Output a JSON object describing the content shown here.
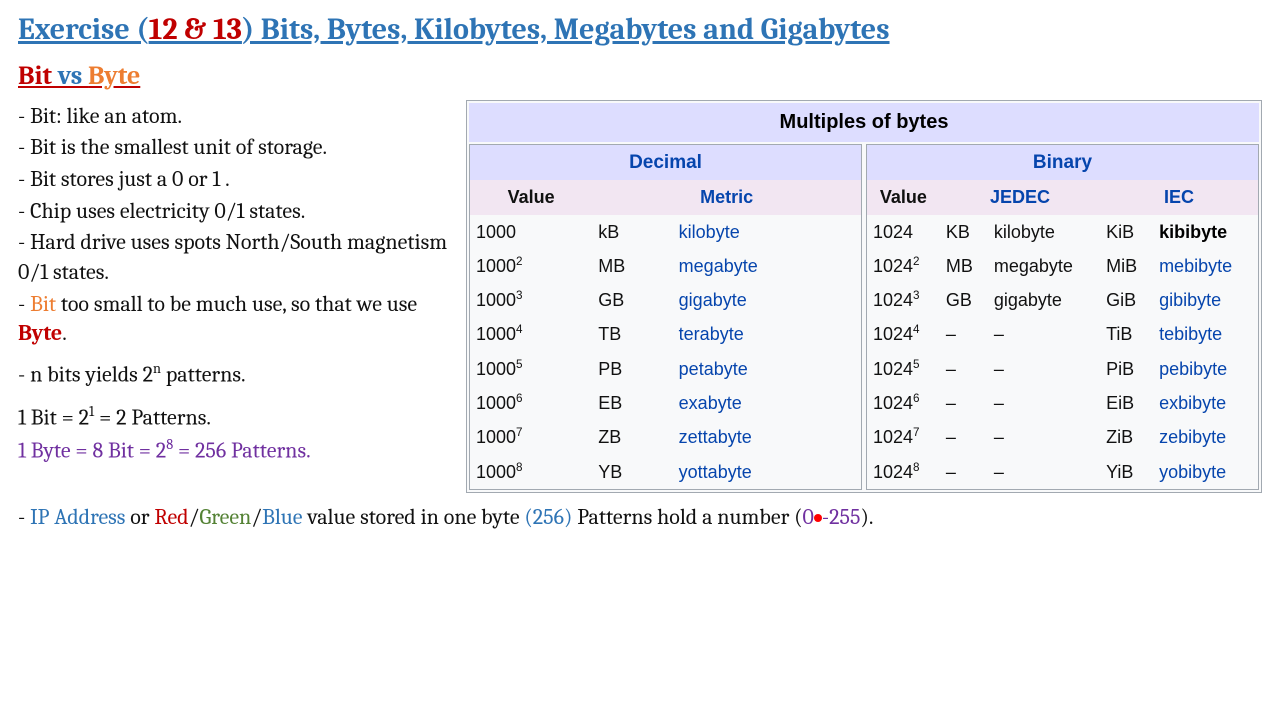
{
  "title": {
    "prefix": "Exercise (",
    "nums": "12 & 13",
    "suffix": ") Bits, Bytes, Kilobytes, Megabytes and Gigabytes"
  },
  "subtitle": {
    "bit": "Bit",
    "vs": " vs ",
    "byte": "Byte"
  },
  "bullets": {
    "b1": "- Bit: like an atom.",
    "b2": "- Bit is the smallest unit of storage.",
    "b3": "- Bit stores just a 0 or 1 .",
    "b4": "- Chip uses electricity 0/1 states.",
    "b5": "- Hard drive uses spots North/South magnetism 0/1 states.",
    "b6a": "- ",
    "b6bit": "Bit",
    "b6b": " too small to be much use, so that we use ",
    "b6byte": "Byte",
    "b6c": ".",
    "b7a": "- n bits yields 2",
    "b7exp": "n",
    "b7b": " patterns.",
    "b8a": "1 Bit = 2",
    "b8exp": "1",
    "b8b": " = 2 Patterns.",
    "b9a": "1 Byte = 8 Bit = 2",
    "b9exp": "8",
    "b9b": " = 256 Patterns."
  },
  "box": {
    "title": "Multiples of bytes"
  },
  "decimal": {
    "heading": "Decimal",
    "val": "Value",
    "met": "Metric",
    "rows": [
      {
        "v": "1000",
        "e": "",
        "a": "kB",
        "n": "kilobyte"
      },
      {
        "v": "1000",
        "e": "2",
        "a": "MB",
        "n": "megabyte"
      },
      {
        "v": "1000",
        "e": "3",
        "a": "GB",
        "n": "gigabyte"
      },
      {
        "v": "1000",
        "e": "4",
        "a": "TB",
        "n": "terabyte"
      },
      {
        "v": "1000",
        "e": "5",
        "a": "PB",
        "n": "petabyte"
      },
      {
        "v": "1000",
        "e": "6",
        "a": "EB",
        "n": "exabyte"
      },
      {
        "v": "1000",
        "e": "7",
        "a": "ZB",
        "n": "zettabyte"
      },
      {
        "v": "1000",
        "e": "8",
        "a": "YB",
        "n": "yottabyte"
      }
    ]
  },
  "binary": {
    "heading": "Binary",
    "val": "Value",
    "jed": "JEDEC",
    "iec": "IEC",
    "rows": [
      {
        "v": "1024",
        "e": "",
        "ja": "KB",
        "jn": "kilobyte",
        "ia": "KiB",
        "in": "kibibyte",
        "bold": true
      },
      {
        "v": "1024",
        "e": "2",
        "ja": "MB",
        "jn": "megabyte",
        "ia": "MiB",
        "in": "mebibyte"
      },
      {
        "v": "1024",
        "e": "3",
        "ja": "GB",
        "jn": "gigabyte",
        "ia": "GiB",
        "in": "gibibyte"
      },
      {
        "v": "1024",
        "e": "4",
        "ja": "–",
        "jn": "–",
        "ia": "TiB",
        "in": "tebibyte"
      },
      {
        "v": "1024",
        "e": "5",
        "ja": "–",
        "jn": "–",
        "ia": "PiB",
        "in": "pebibyte"
      },
      {
        "v": "1024",
        "e": "6",
        "ja": "–",
        "jn": "–",
        "ia": "EiB",
        "in": "exbibyte"
      },
      {
        "v": "1024",
        "e": "7",
        "ja": "–",
        "jn": "–",
        "ia": "ZiB",
        "in": "zebibyte"
      },
      {
        "v": "1024",
        "e": "8",
        "ja": "–",
        "jn": "–",
        "ia": "YiB",
        "in": "yobibyte"
      }
    ]
  },
  "footer": {
    "a": "- ",
    "ip": "IP Address",
    "b": " or ",
    "r": "Red",
    "s1": "/",
    "g": "Green",
    "s2": "/",
    "bl": "Blue",
    "c": " value stored in one byte ",
    "n256o": "(256)",
    "d": " Patterns hold a number (",
    "r0": "0",
    "dash": "-",
    "r255": "255",
    "e": ")."
  }
}
